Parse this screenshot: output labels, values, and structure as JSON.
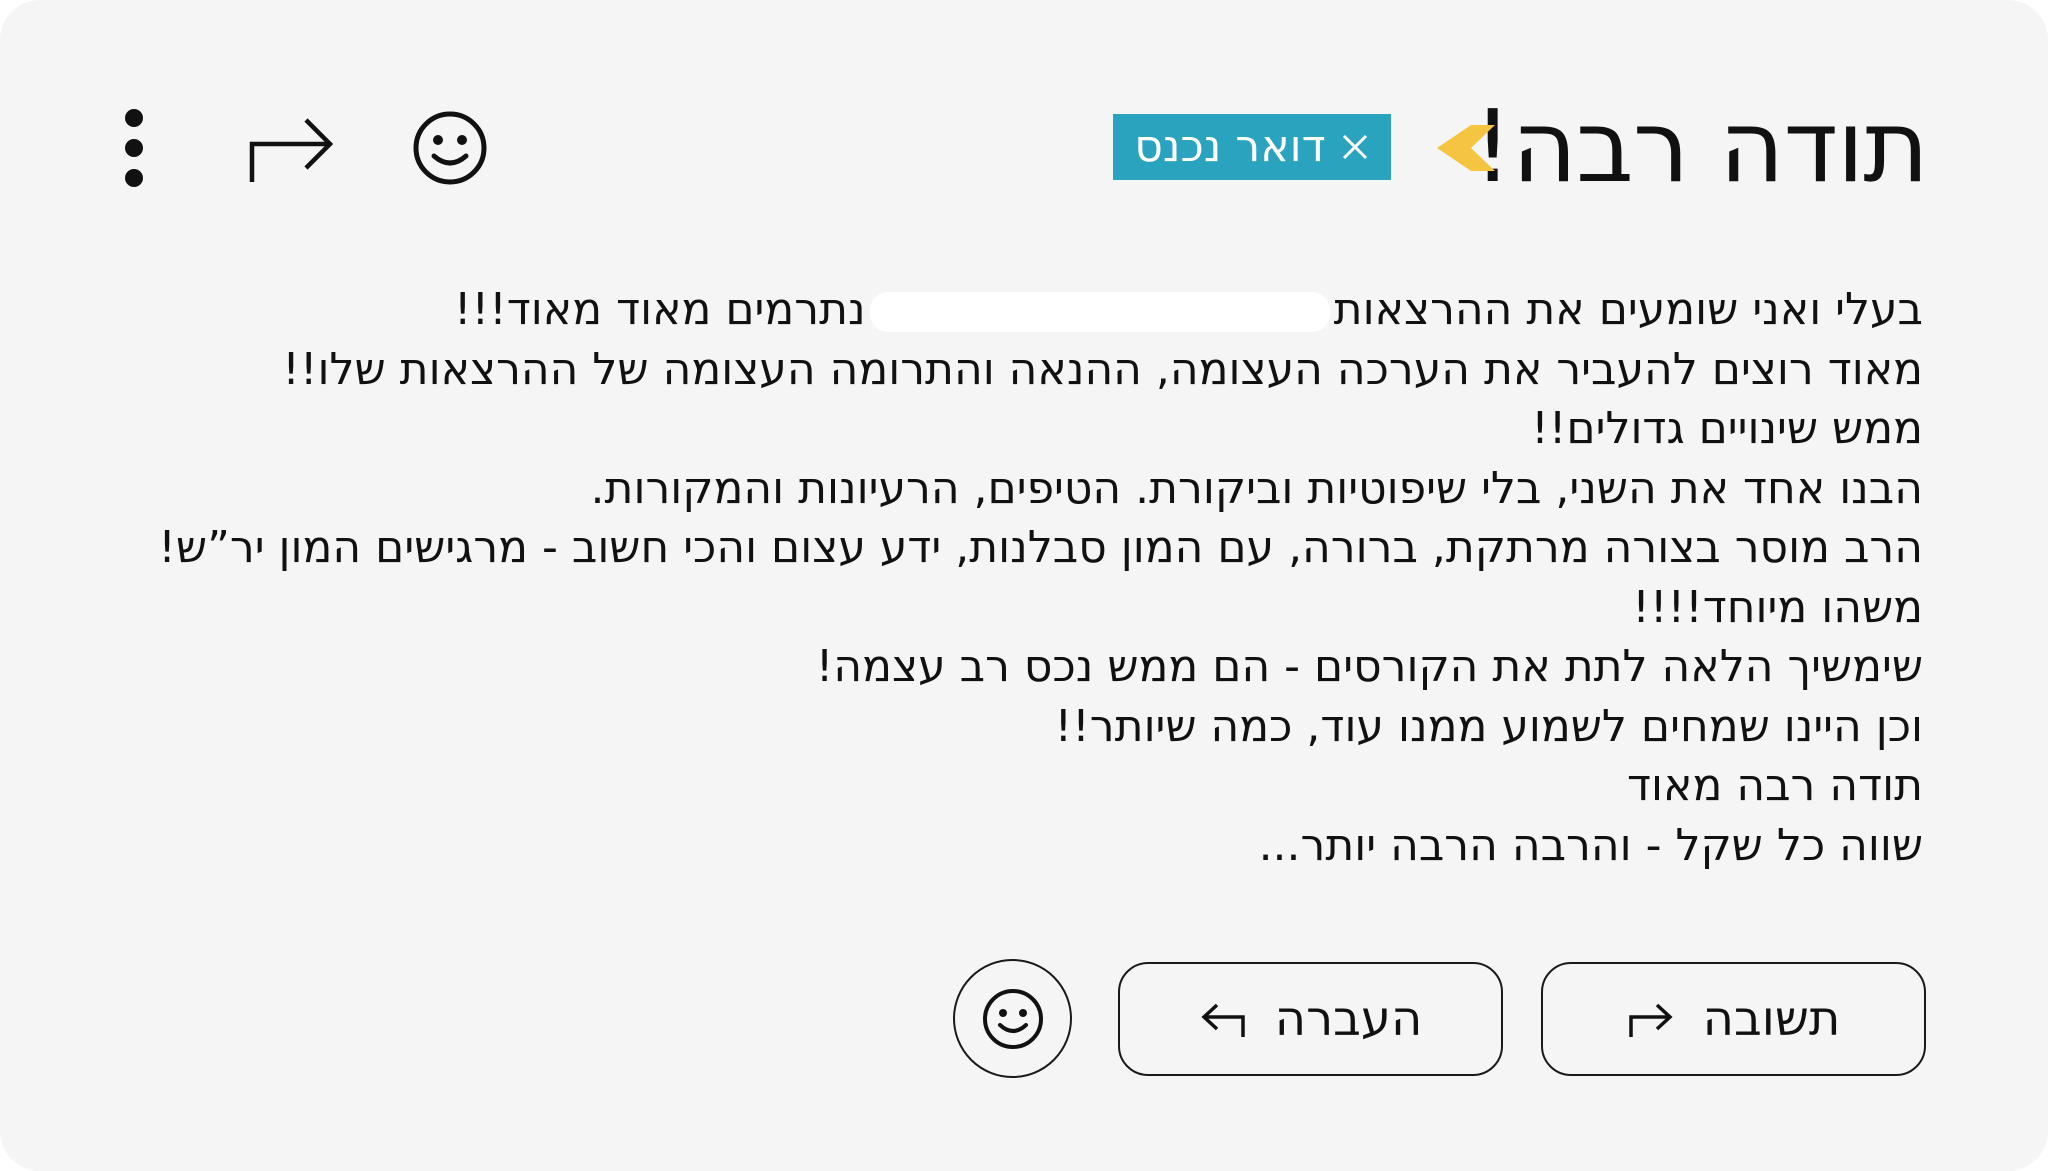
{
  "email": {
    "subject": "תודה רבה!",
    "label": {
      "text": "דואר נכנס",
      "color": "#2aa3be"
    },
    "important_marker_color": "#f5c542",
    "body_lines": [
      {
        "before": "בעלי ואני שומעים את ההרצאות",
        "after": "נתרמים מאוד מאוד!!!"
      },
      {
        "text": "מאוד רוצים להעביר את הערכה העצומה, ההנאה והתרומה העצומה של ההרצאות שלו!!"
      },
      {
        "text": "ממש שינויים גדולים!!"
      },
      {
        "text": "הבנו אחד את השני, בלי שיפוטיות וביקורת. הטיפים, הרעיונות והמקורות."
      },
      {
        "text": "הרב מוסר בצורה מרתקת, ברורה, עם המון סבלנות, ידע עצום והכי חשוב - מרגישים המון יר”ש!"
      },
      {
        "text": "משהו מיוחד!!!!"
      },
      {
        "text": "שימשיך הלאה לתת את הקורסים - הם ממש נכס רב עצמה!"
      },
      {
        "text": "וכן היינו שמחים לשמוע ממנו עוד, כמה שיותר!!"
      },
      {
        "text": "תודה רבה מאוד"
      },
      {
        "text": "שווה כל שקל - והרבה הרבה יותר..."
      }
    ]
  },
  "header_actions": {
    "emoji_icon": "emoji-smile-icon",
    "forward_icon": "forward-arrow-icon",
    "more_icon": "more-vertical-icon"
  },
  "actions": {
    "reply_label": "תשובה",
    "forward_label": "העברה",
    "emoji_icon": "emoji-smile-icon"
  }
}
